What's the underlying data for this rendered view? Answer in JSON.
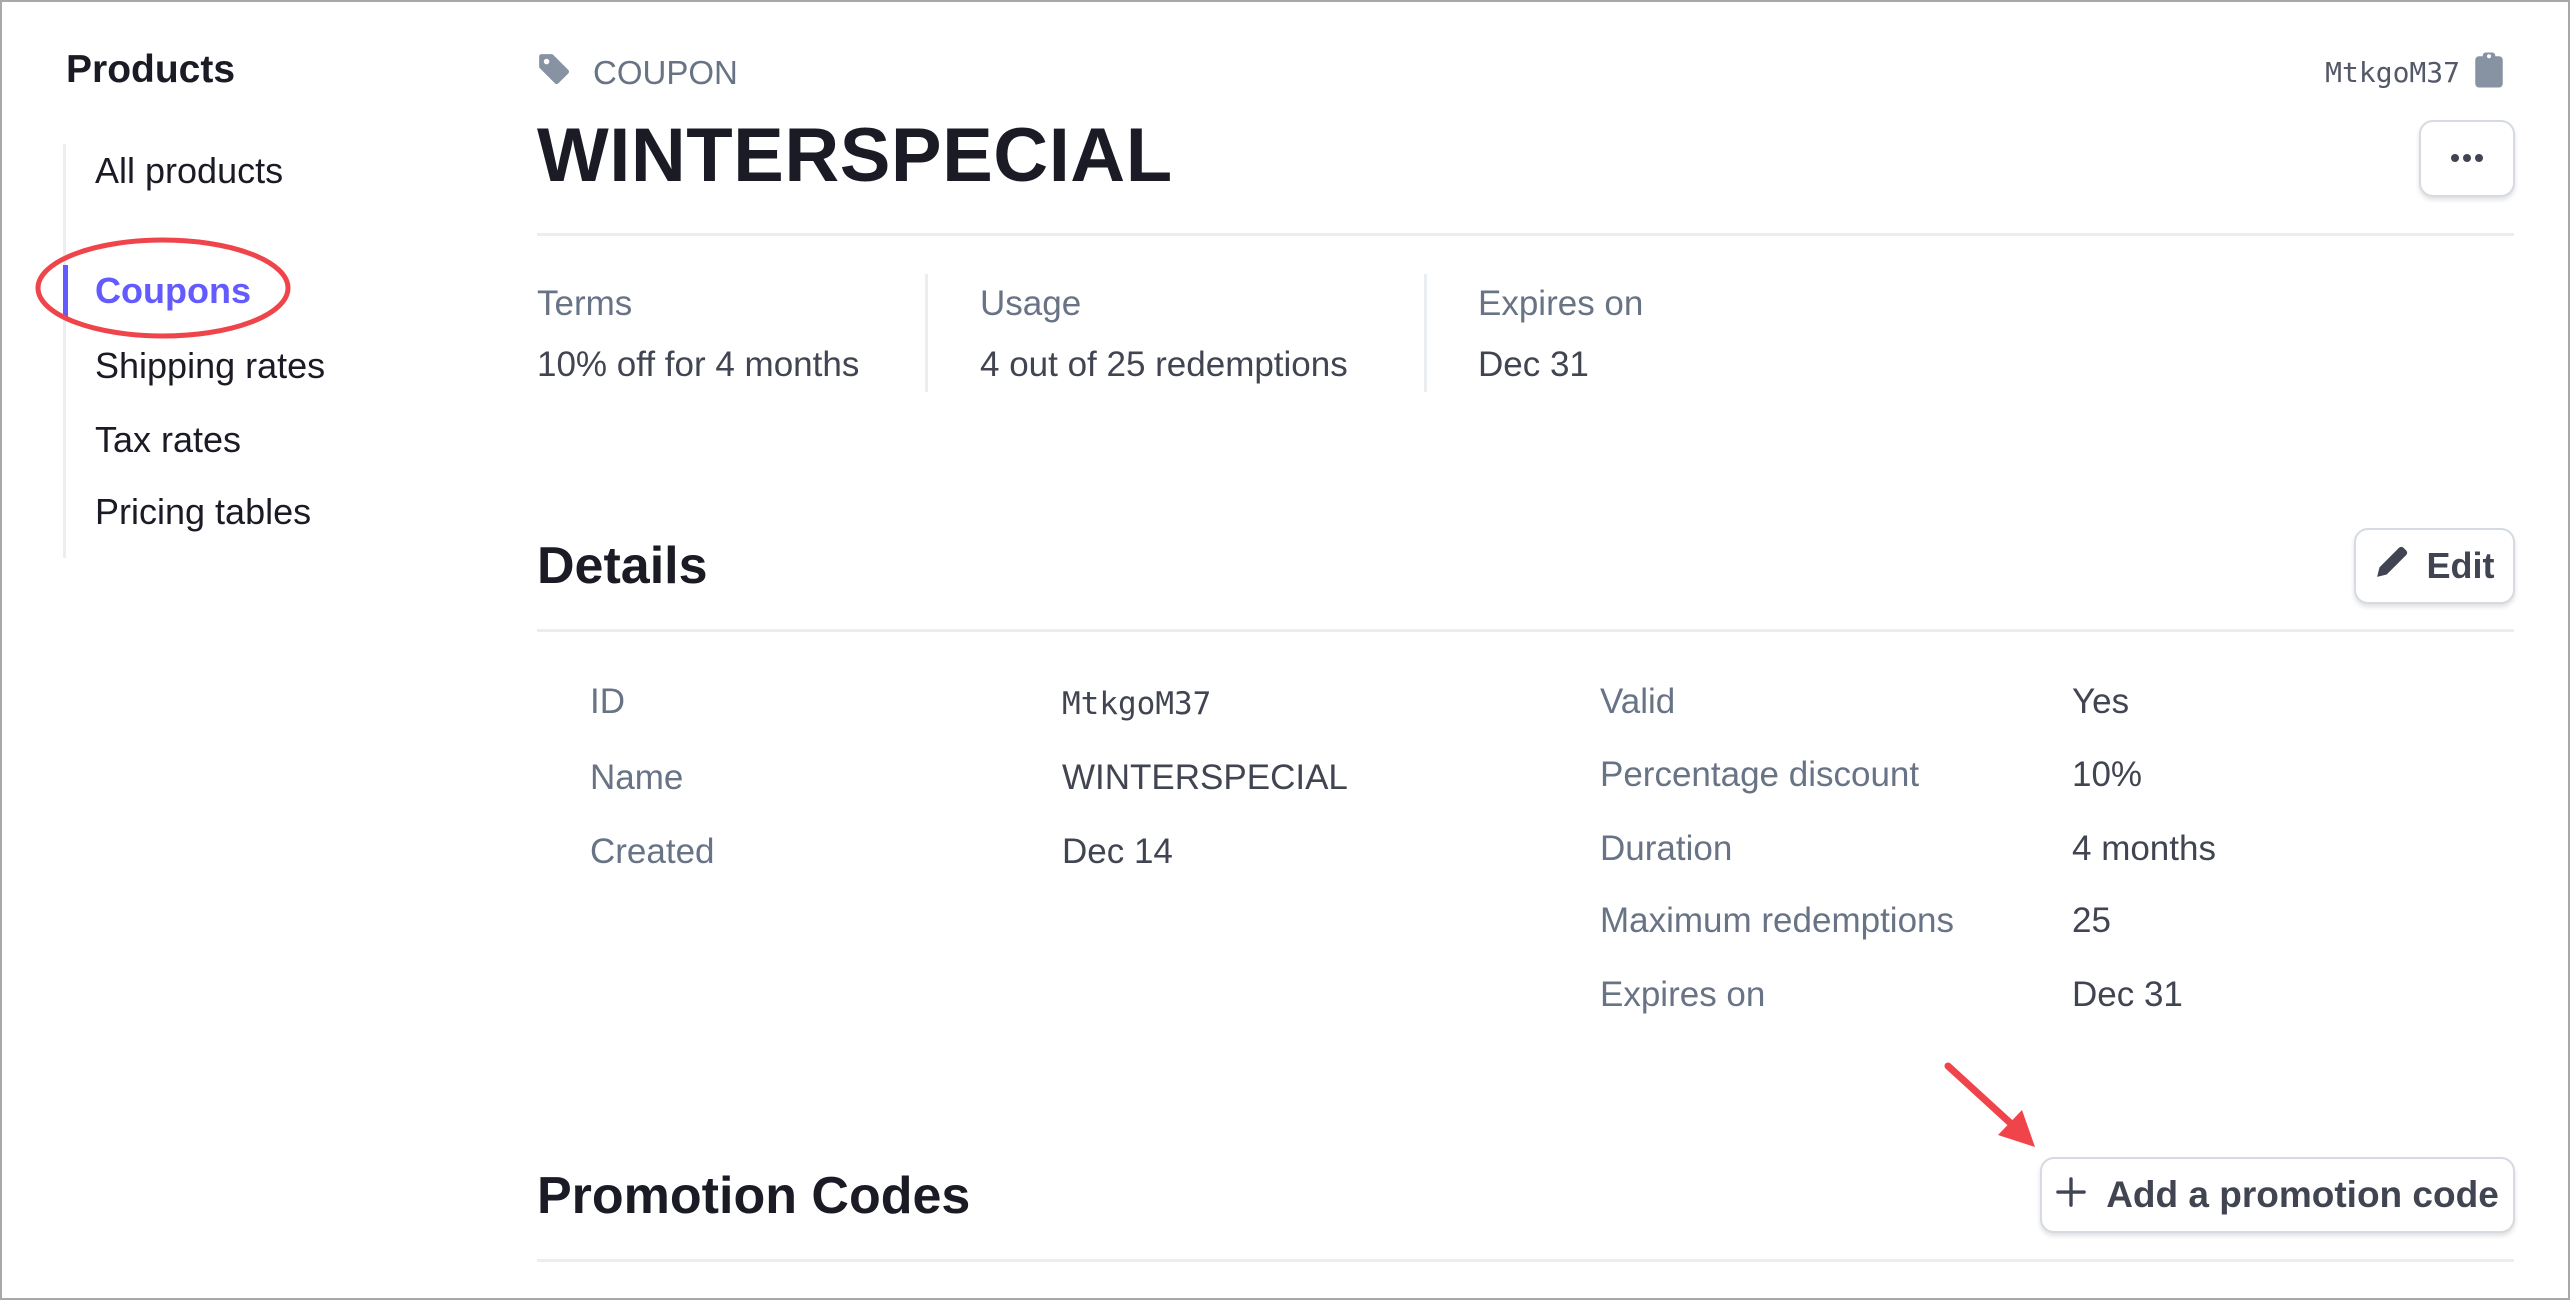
{
  "sidebar": {
    "title": "Products",
    "items": [
      {
        "label": "All products",
        "active": false
      },
      {
        "label": "Coupons",
        "active": true
      },
      {
        "label": "Shipping rates",
        "active": false
      },
      {
        "label": "Tax rates",
        "active": false
      },
      {
        "label": "Pricing tables",
        "active": false
      }
    ]
  },
  "header": {
    "type_label": "COUPON",
    "type_icon": "tag-icon",
    "title": "WINTERSPECIAL",
    "object_id": "MtkgoM37",
    "copy_icon": "clipboard-icon",
    "more_icon": "ellipsis-icon"
  },
  "summary": [
    {
      "label": "Terms",
      "value": "10% off for 4 months"
    },
    {
      "label": "Usage",
      "value": "4 out of 25 redemptions"
    },
    {
      "label": "Expires on",
      "value": "Dec 31"
    }
  ],
  "details": {
    "heading": "Details",
    "edit_label": "Edit",
    "edit_icon": "pencil-icon",
    "left": [
      {
        "label": "ID",
        "value": "MtkgoM37"
      },
      {
        "label": "Name",
        "value": "WINTERSPECIAL"
      },
      {
        "label": "Created",
        "value": "Dec 14"
      }
    ],
    "right": [
      {
        "label": "Valid",
        "value": "Yes"
      },
      {
        "label": "Percentage discount",
        "value": "10%"
      },
      {
        "label": "Duration",
        "value": "4 months"
      },
      {
        "label": "Maximum redemptions",
        "value": "25"
      },
      {
        "label": "Expires on",
        "value": "Dec 31"
      }
    ]
  },
  "promotion_codes": {
    "heading": "Promotion Codes",
    "add_label": "Add a promotion code",
    "add_icon": "plus-icon"
  },
  "colors": {
    "accent": "#635bff",
    "annotation": "#f0444b",
    "text_primary": "#1a1b25",
    "text_secondary": "#687385"
  }
}
